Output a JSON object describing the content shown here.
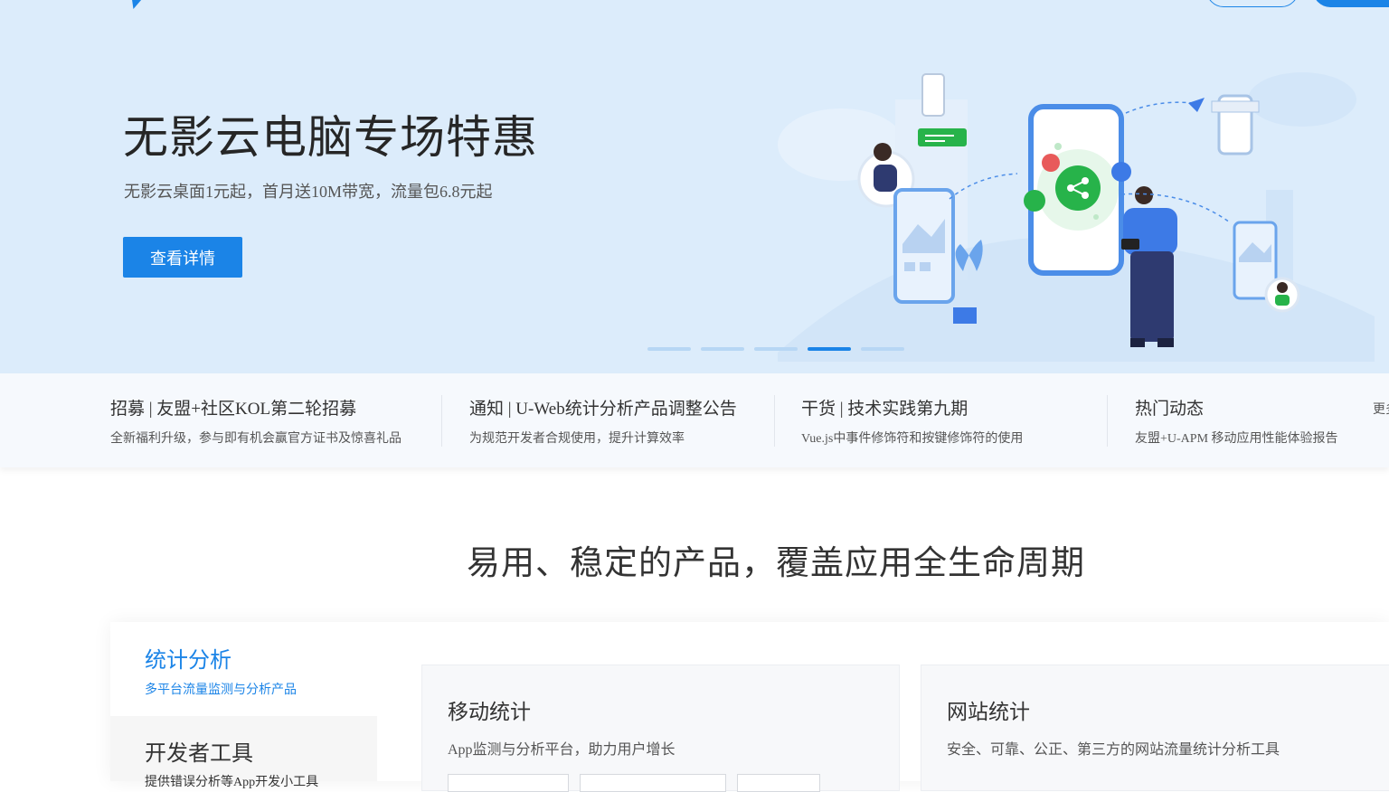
{
  "hero": {
    "title": "无影云电脑专场特惠",
    "subtitle": "无影云桌面1元起，首月送10M带宽，流量包6.8元起",
    "cta_label": "查看详情",
    "carousel_total": 5,
    "carousel_active_index": 3
  },
  "notices": [
    {
      "title": "招募 | 友盟+社区KOL第二轮招募",
      "desc": "全新福利升级，参与即有机会赢官方证书及惊喜礼品"
    },
    {
      "title": "通知 | U-Web统计分析产品调整公告",
      "desc": "为规范开发者合规使用，提升计算效率"
    },
    {
      "title": "干货 | 技术实践第九期",
      "desc": "Vue.js中事件修饰符和按键修饰符的使用"
    },
    {
      "title": "热门动态",
      "desc": "友盟+U-APM 移动应用性能体验报告"
    }
  ],
  "notice_more": "更多",
  "section_title": "易用、稳定的产品，覆盖应用全生命周期",
  "categories": [
    {
      "title": "统计分析",
      "desc": "多平台流量监测与分析产品",
      "active": true
    },
    {
      "title": "开发者工具",
      "desc": "提供错误分析等App开发小工具",
      "active": false
    }
  ],
  "products": [
    {
      "title": "移动统计",
      "desc": "App监测与分析平台，助力用户增长"
    },
    {
      "title": "网站统计",
      "desc": "安全、可靠、公正、第三方的网站流量统计分析工具"
    }
  ],
  "colors": {
    "accent": "#1b84e7",
    "hero_bg": "#dcecfb",
    "share_green": "#27b34a"
  }
}
